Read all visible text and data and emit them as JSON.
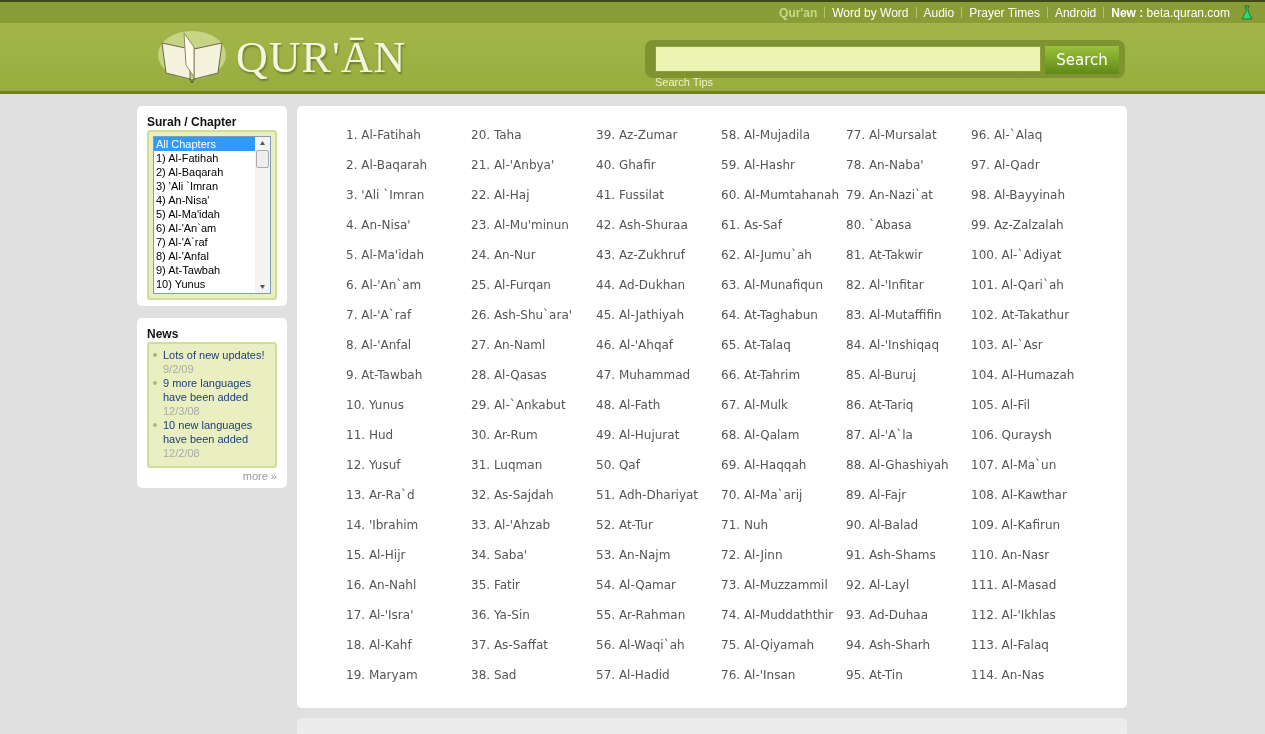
{
  "top_nav": [
    {
      "label": "Qur'an",
      "selected": true
    },
    {
      "label": "Word by Word",
      "selected": false
    },
    {
      "label": "Audio",
      "selected": false
    },
    {
      "label": "Prayer Times",
      "selected": false
    },
    {
      "label": "Android",
      "selected": false
    },
    {
      "label": "**New :** beta.quran.com",
      "selected": false
    }
  ],
  "logo": {
    "text": "QUR'ĀN"
  },
  "search": {
    "button": "Search",
    "tips": "Search Tips"
  },
  "chapter_picker": {
    "title": "Surah / Chapter",
    "options": [
      {
        "label": "All Chapters",
        "selected": true
      },
      {
        "label": "1) Al-Fatihah",
        "selected": false
      },
      {
        "label": "2) Al-Baqarah",
        "selected": false
      },
      {
        "label": "3) 'Ali `Imran",
        "selected": false
      },
      {
        "label": "4) An-Nisa'",
        "selected": false
      },
      {
        "label": "5) Al-Ma'idah",
        "selected": false
      },
      {
        "label": "6) Al-'An`am",
        "selected": false
      },
      {
        "label": "7) Al-'A`raf",
        "selected": false
      },
      {
        "label": "8) Al-'Anfal",
        "selected": false
      },
      {
        "label": "9) At-Tawbah",
        "selected": false
      },
      {
        "label": "10) Yunus",
        "selected": false
      }
    ]
  },
  "news": {
    "title": "News",
    "items": [
      {
        "text": "Lots of new updates!",
        "date": "9/2/09"
      },
      {
        "text": "9 more languages have been added",
        "date": "12/3/08"
      },
      {
        "text": "10 new languages have been added",
        "date": "12/2/08"
      }
    ],
    "more": "more »"
  },
  "chapters": [
    "1. Al-Fatihah",
    "2. Al-Baqarah",
    "3. 'Ali `Imran",
    "4. An-Nisa'",
    "5. Al-Ma'idah",
    "6. Al-'An`am",
    "7. Al-'A`raf",
    "8. Al-'Anfal",
    "9. At-Tawbah",
    "10. Yunus",
    "11. Hud",
    "12. Yusuf",
    "13. Ar-Ra`d",
    "14. 'Ibrahim",
    "15. Al-Hijr",
    "16. An-Nahl",
    "17. Al-'Isra'",
    "18. Al-Kahf",
    "19. Maryam",
    "20. Taha",
    "21. Al-'Anbya'",
    "22. Al-Haj",
    "23. Al-Mu'minun",
    "24. An-Nur",
    "25. Al-Furqan",
    "26. Ash-Shu`ara'",
    "27. An-Naml",
    "28. Al-Qasas",
    "29. Al-`Ankabut",
    "30. Ar-Rum",
    "31. Luqman",
    "32. As-Sajdah",
    "33. Al-'Ahzab",
    "34. Saba'",
    "35. Fatir",
    "36. Ya-Sin",
    "37. As-Saffat",
    "38. Sad",
    "39. Az-Zumar",
    "40. Ghafir",
    "41. Fussilat",
    "42. Ash-Shuraa",
    "43. Az-Zukhruf",
    "44. Ad-Dukhan",
    "45. Al-Jathiyah",
    "46. Al-'Ahqaf",
    "47. Muhammad",
    "48. Al-Fath",
    "49. Al-Hujurat",
    "50. Qaf",
    "51. Adh-Dhariyat",
    "52. At-Tur",
    "53. An-Najm",
    "54. Al-Qamar",
    "55. Ar-Rahman",
    "56. Al-Waqi`ah",
    "57. Al-Hadid",
    "58. Al-Mujadila",
    "59. Al-Hashr",
    "60. Al-Mumtahanah",
    "61. As-Saf",
    "62. Al-Jumu`ah",
    "63. Al-Munafiqun",
    "64. At-Taghabun",
    "65. At-Talaq",
    "66. At-Tahrim",
    "67. Al-Mulk",
    "68. Al-Qalam",
    "69. Al-Haqqah",
    "70. Al-Ma`arij",
    "71. Nuh",
    "72. Al-Jinn",
    "73. Al-Muzzammil",
    "74. Al-Muddaththir",
    "75. Al-Qiyamah",
    "76. Al-'Insan",
    "77. Al-Mursalat",
    "78. An-Naba'",
    "79. An-Nazi`at",
    "80. `Abasa",
    "81. At-Takwir",
    "82. Al-'Infitar",
    "83. Al-Mutaffifin",
    "84. Al-'Inshiqaq",
    "85. Al-Buruj",
    "86. At-Tariq",
    "87. Al-'A`la",
    "88. Al-Ghashiyah",
    "89. Al-Fajr",
    "90. Al-Balad",
    "91. Ash-Shams",
    "92. Al-Layl",
    "93. Ad-Duhaa",
    "94. Ash-Sharh",
    "95. At-Tin",
    "96. Al-`Alaq",
    "97. Al-Qadr",
    "98. Al-Bayyinah",
    "99. Az-Zalzalah",
    "100. Al-`Adiyat",
    "101. Al-Qari`ah",
    "102. At-Takathur",
    "103. Al-`Asr",
    "104. Al-Humazah",
    "105. Al-Fil",
    "106. Quraysh",
    "107. Al-Ma`un",
    "108. Al-Kawthar",
    "109. Al-Kafirun",
    "110. An-Nasr",
    "111. Al-Masad",
    "112. Al-'Ikhlas",
    "113. Al-Falaq",
    "114. An-Nas"
  ]
}
